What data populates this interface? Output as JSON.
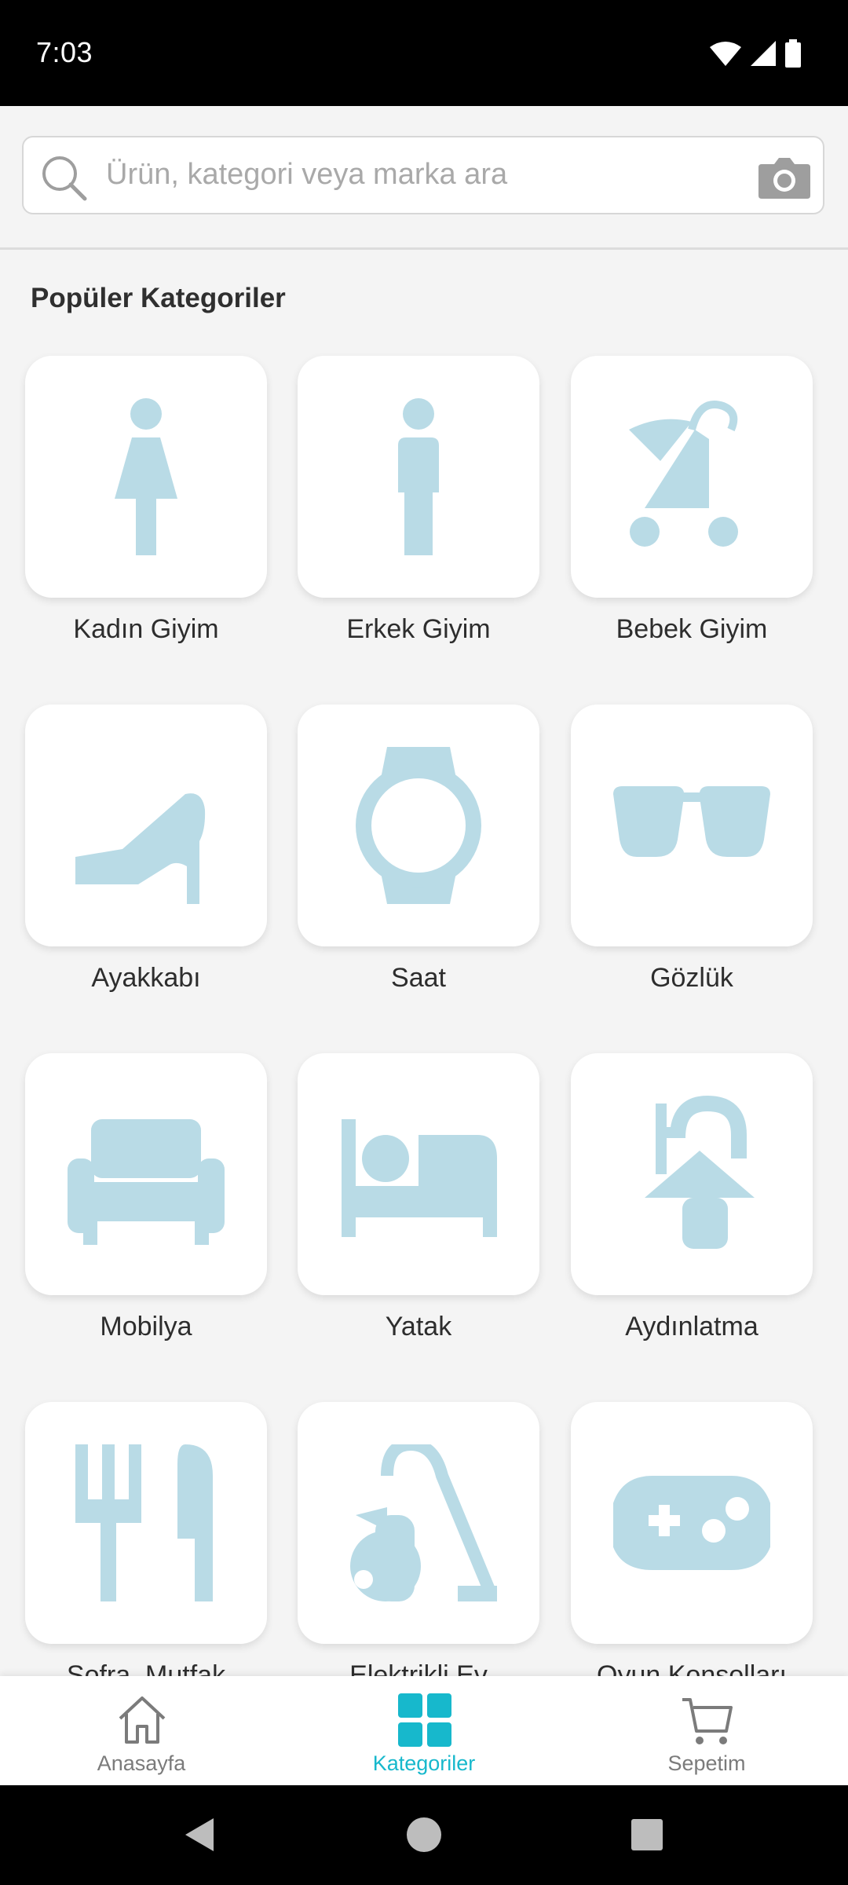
{
  "status": {
    "time": "7:03"
  },
  "search": {
    "placeholder": "Ürün, kategori veya marka ara"
  },
  "section": {
    "title": "Popüler Kategoriler"
  },
  "categories": [
    {
      "label": "Kadın Giyim",
      "icon": "woman-icon"
    },
    {
      "label": "Erkek Giyim",
      "icon": "man-icon"
    },
    {
      "label": "Bebek Giyim",
      "icon": "stroller-icon"
    },
    {
      "label": "Ayakkabı",
      "icon": "high-heel-icon"
    },
    {
      "label": "Saat",
      "icon": "watch-icon"
    },
    {
      "label": "Gözlük",
      "icon": "sunglasses-icon"
    },
    {
      "label": "Mobilya",
      "icon": "sofa-icon"
    },
    {
      "label": "Yatak",
      "icon": "bed-icon"
    },
    {
      "label": "Aydınlatma",
      "icon": "lamp-icon"
    },
    {
      "label": "Sofra, Mutfak",
      "icon": "cutlery-icon"
    },
    {
      "label": "Elektrikli Ev",
      "icon": "vacuum-icon"
    },
    {
      "label": "Oyun Konsolları",
      "icon": "gamepad-icon"
    }
  ],
  "nav": [
    {
      "label": "Anasayfa",
      "icon": "home-icon",
      "active": false
    },
    {
      "label": "Kategoriler",
      "icon": "grid-icon",
      "active": true
    },
    {
      "label": "Sepetim",
      "icon": "cart-icon",
      "active": false
    }
  ],
  "colors": {
    "icon": "#b9dbe6",
    "accent": "#17b8cc"
  }
}
